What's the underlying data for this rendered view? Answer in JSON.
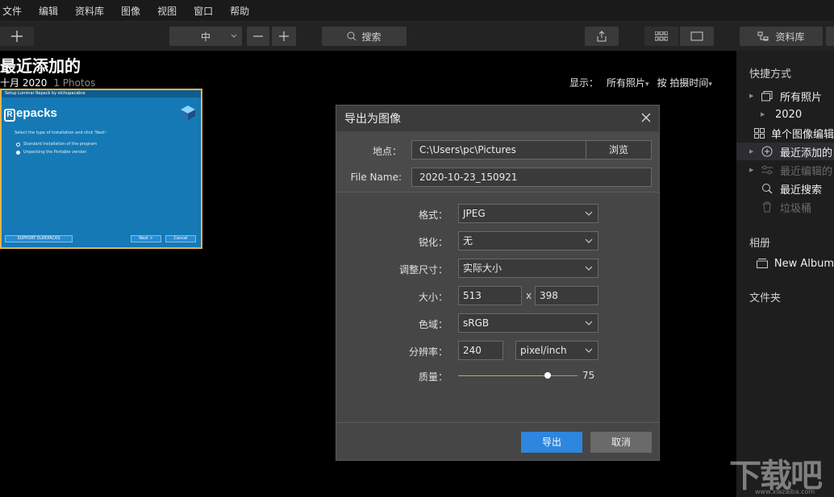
{
  "menu": [
    "文件",
    "编辑",
    "资料库",
    "图像",
    "视图",
    "窗口",
    "帮助"
  ],
  "toolbar": {
    "zoom_value": "中",
    "search_label": "搜索",
    "library_label": "资料库"
  },
  "main": {
    "title": "最近添加的",
    "date": "十月 2020",
    "photo_count": "1 Photos",
    "show_label": "显示：",
    "show_value": "所有照片",
    "sort_label": "按 拍摄时间"
  },
  "thumbnail": {
    "window_title": "Setup Luminar Repack by elchupacabra",
    "logo_text": "epacks",
    "logo_letter": "R",
    "instruction": "Select the type of installation and click 'Next':",
    "option1": "Standard installation of the program",
    "option2": "Unpacking the Portable version",
    "support_btn": "SUPPORT ELREPACKS",
    "next_btn": "Next >",
    "cancel_btn": "Cancel"
  },
  "sidebar": {
    "shortcuts_heading": "快捷方式",
    "items": [
      {
        "label": "所有照片"
      },
      {
        "label": "2020"
      },
      {
        "label": "单个图像编辑"
      },
      {
        "label": "最近添加的"
      },
      {
        "label": "最近编辑的"
      },
      {
        "label": "最近搜索"
      },
      {
        "label": "垃圾桶"
      }
    ],
    "albums_heading": "相册",
    "album_item": "New Album",
    "folders_heading": "文件夹"
  },
  "dialog": {
    "title": "导出为图像",
    "location_label": "地点：",
    "location_value": "C:\\Users\\pc\\Pictures",
    "browse_label": "浏览",
    "filename_label": "File Name:",
    "filename_value": "2020-10-23_150921",
    "format_label": "格式：",
    "format_value": "JPEG",
    "sharpen_label": "锐化：",
    "sharpen_value": "无",
    "resize_label": "调整尺寸：",
    "resize_value": "实际大小",
    "size_label": "大小：",
    "size_width": "513",
    "size_x": "x",
    "size_height": "398",
    "colorspace_label": "色域：",
    "colorspace_value": "sRGB",
    "resolution_label": "分辨率：",
    "resolution_value": "240",
    "resolution_unit": "pixel/inch",
    "quality_label": "质量：",
    "quality_value": "75",
    "quality_fraction": 0.75,
    "export_button": "导出",
    "cancel_button": "取消"
  },
  "watermark": {
    "big": "下载吧",
    "small": "www.xiazaiba.com"
  },
  "colors": {
    "accent": "#2e86de",
    "slider": "#d4a648",
    "selection_border": "#e6b34a"
  }
}
